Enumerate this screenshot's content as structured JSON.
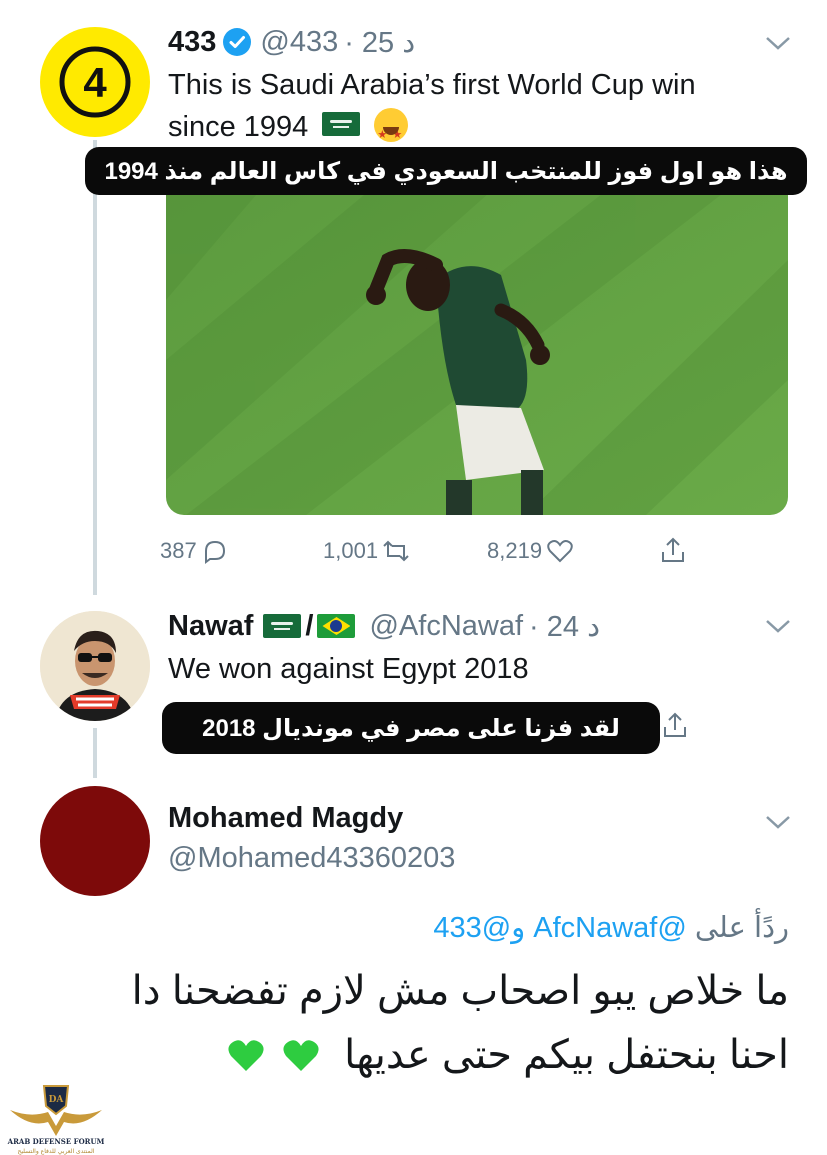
{
  "tweet1": {
    "avatar_label": "4",
    "name": "433",
    "handle": "@433",
    "time": "· 25 د",
    "text_line1": "This is Saudi Arabia’s first World Cup win",
    "text_line2": "since 1994",
    "translation": "هذا هو اول فوز للمنتخب السعودي في كاس العالم منذ 1994",
    "replies": "387",
    "retweets": "1,001",
    "likes": "8,219"
  },
  "tweet2": {
    "name": "Nawaf",
    "handle": "@AfcNawaf",
    "time": "· 24 د",
    "text": "We won against Egypt 2018",
    "translation": "لقد فزنا على مصر في مونديال 2018"
  },
  "tweet3": {
    "name": "Mohamed Magdy",
    "handle": "@Mohamed43360203",
    "reply_label": "ردًأ على",
    "reply_mentions": "@AfcNawaf و@433",
    "text_line1": "ما خلاص يبو اصحاب مش لازم تفضحنا دا",
    "text_line2": "احنا بنحتفل بيكم حتى عديها"
  },
  "watermark": {
    "title": "ARAB DEFENSE FORUM",
    "subtitle": "المنتدى العربي للدفاع والتسليح"
  },
  "colors": {
    "accent": "#1da1f2",
    "muted": "#657786",
    "avatar_433": "#ffea00",
    "avatar_magdy": "#7d0a0a",
    "heart": "#2ecc40"
  }
}
